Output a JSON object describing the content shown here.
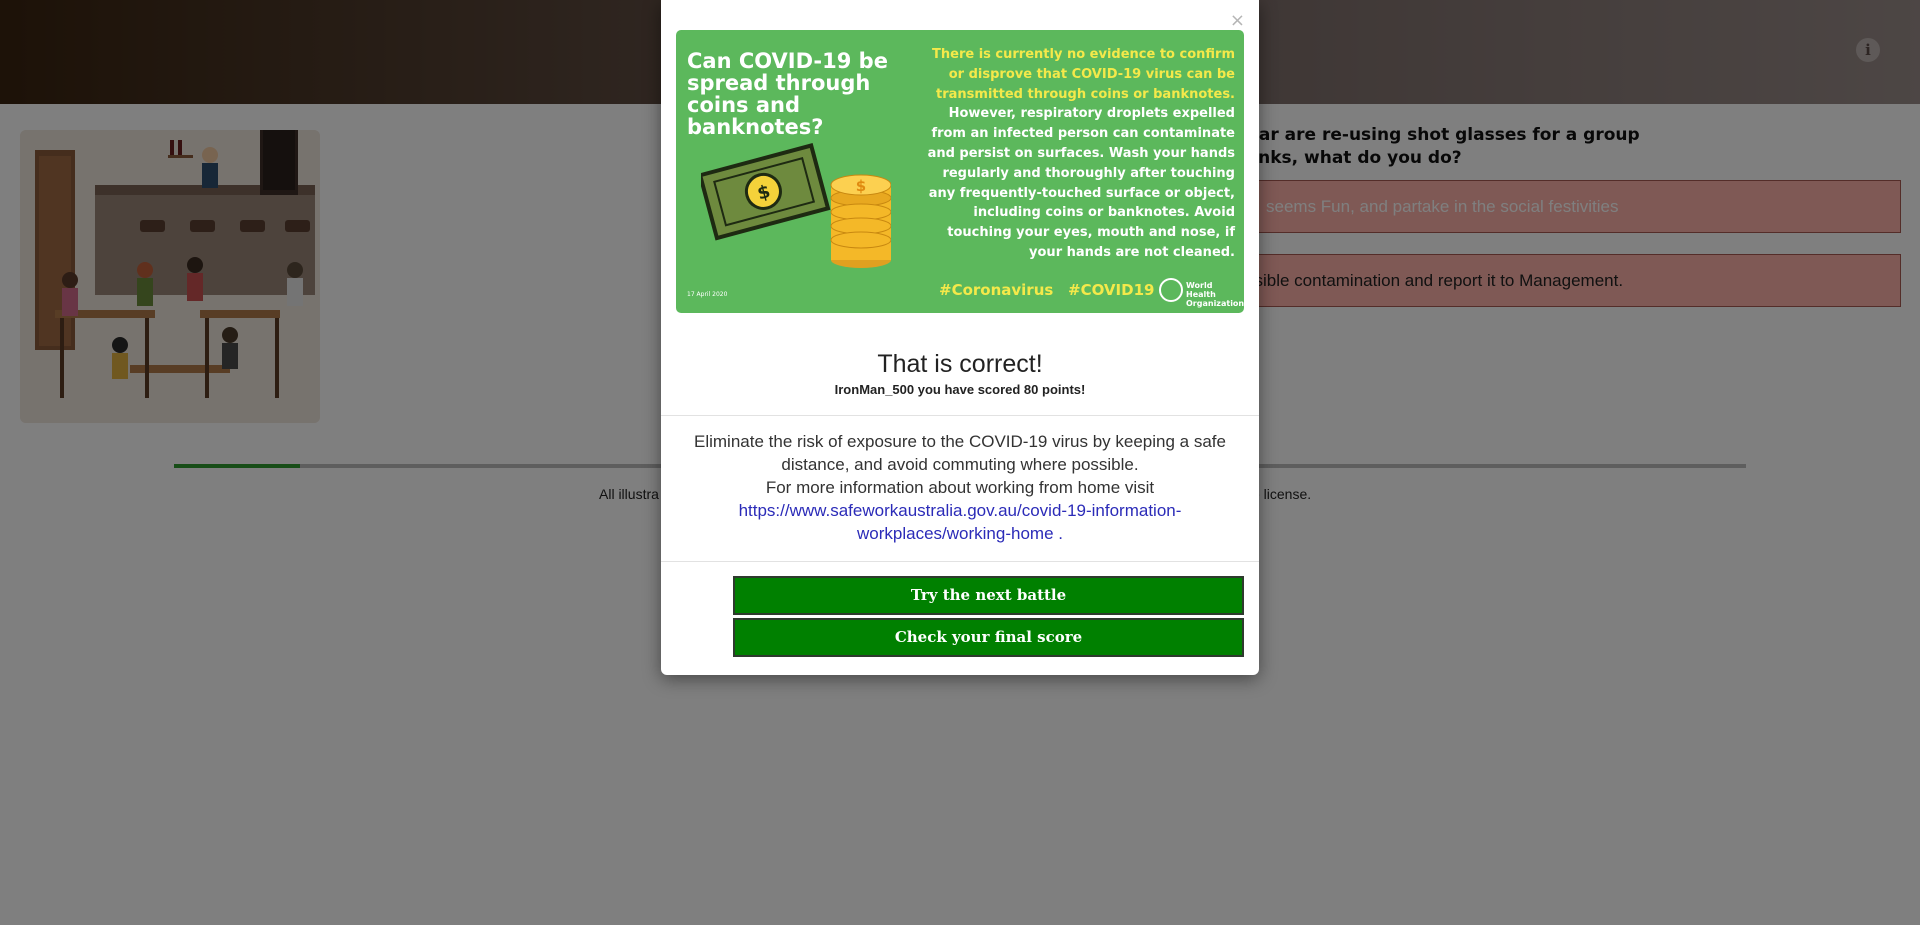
{
  "question": {
    "line1": "t the bar are re-using shot glasses for a group",
    "line2": "l of drinks, what do you do?"
  },
  "answers": [
    {
      "text": "seems Fun, and partake in the social festivities"
    },
    {
      "text": "ssible contamination and report it to Management."
    }
  ],
  "progress": {
    "fraction": 0.08
  },
  "footer": {
    "left": "All illustra",
    "right": "se license."
  },
  "icons": {
    "info": "info-icon",
    "close": "close-icon"
  },
  "colors": {
    "banner_bg": "#5cb85c",
    "button_bg": "#008000",
    "answer_bg": "#ffb3aa",
    "progress": "#2e9a2e"
  },
  "modal": {
    "close_label": "×",
    "banner": {
      "title": "Can COVID-19 be spread through coins and banknotes?",
      "yellow_text": "There is currently no evidence to confirm or disprove that COVID-19 virus can be transmitted through coins or banknotes.",
      "white_text_1": "However, respiratory droplets expelled from an infected person can contaminate and persist on surfaces.",
      "white_text_2": "Wash your hands regularly and thoroughly after touching any frequently-touched surface or object, including coins or banknotes.",
      "white_text_3": "Avoid touching your eyes, mouth and nose, if your hands are not cleaned.",
      "date": "17 April 2020",
      "hashtag1": "#Coronavirus",
      "hashtag2": "#COVID19",
      "logo_text_1": "World Health",
      "logo_text_2": "Organization"
    },
    "result_title": "That is correct!",
    "result_score": "IronMan_500 you have scored 80 points!",
    "message_line1": "Eliminate the risk of exposure to the COVID-19 virus by keeping a safe distance, and avoid commuting where possible.",
    "message_line2": "For more information about working from home visit",
    "link_text": "https://www.safeworkaustralia.gov.au/covid-19-information-workplaces/working-home",
    "link_suffix": " .",
    "next_button": "Try the next battle",
    "score_button": "Check your final score"
  }
}
